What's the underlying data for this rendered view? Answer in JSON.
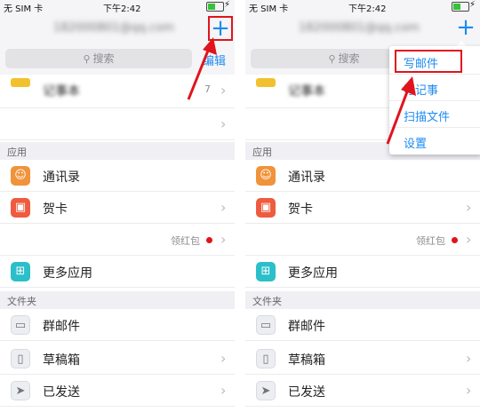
{
  "status": {
    "carrier": "无 SIM 卡",
    "time": "下午2:42",
    "battery_level": 0.5
  },
  "header": {
    "account": "182000801@qq.com",
    "add_glyph": "+"
  },
  "search": {
    "placeholder": "搜索",
    "edit": "编辑"
  },
  "top_rows": [
    {
      "label": "记事本",
      "count": "7"
    }
  ],
  "sections": {
    "apps": "应用",
    "folders": "文件夹"
  },
  "apps": [
    {
      "label": "通讯录",
      "icon": "contacts-icon",
      "color": "#f0933a"
    },
    {
      "label": "贺卡",
      "icon": "card-icon",
      "color": "#ee5b3f"
    },
    {
      "label": "",
      "badge": "领红包"
    },
    {
      "label": "更多应用",
      "icon": "apps-grid-icon",
      "color": "#2bbfc9"
    }
  ],
  "folders": [
    {
      "label": "群邮件",
      "icon": "folder-icon"
    },
    {
      "label": "草稿箱",
      "icon": "draft-icon"
    },
    {
      "label": "已发送",
      "icon": "send-icon"
    }
  ],
  "menu": {
    "items": [
      "写邮件",
      "写记事",
      "扫描文件",
      "设置"
    ]
  },
  "colors": {
    "accent": "#1d8bf0",
    "highlight": "#e0141c",
    "section_bg": "#efeff4"
  }
}
